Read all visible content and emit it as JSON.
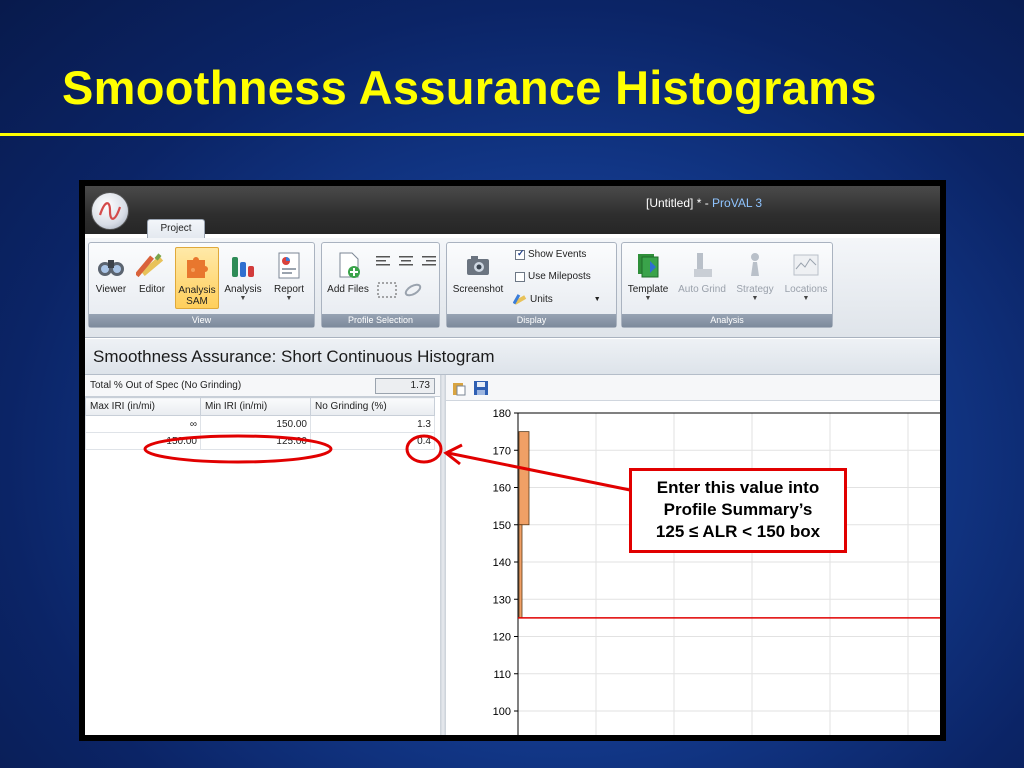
{
  "slide": {
    "title": "Smoothness Assurance Histograms"
  },
  "app": {
    "window_title_prefix": "[Untitled] * - ",
    "window_title_brand": "ProVAL 3",
    "ribbon_tab": "Project",
    "groups": {
      "view": "View",
      "profile_selection": "Profile Selection",
      "display": "Display",
      "analysis": "Analysis"
    },
    "buttons": {
      "viewer": "Viewer",
      "editor": "Editor",
      "analysis_sam_line1": "Analysis",
      "analysis_sam_line2": "SAM",
      "analysis": "Analysis",
      "report": "Report",
      "add_files": "Add Files",
      "screenshot": "Screenshot",
      "show_events": "Show Events",
      "use_mileposts": "Use Mileposts",
      "units": "Units",
      "template": "Template",
      "auto_grind": "Auto Grind",
      "strategy": "Strategy",
      "locations": "Locations"
    },
    "checkboxes": {
      "show_events_checked": true,
      "use_mileposts_checked": false
    },
    "panel_header": "Smoothness Assurance: Short Continuous Histogram",
    "total": {
      "label": "Total % Out of Spec (No Grinding)",
      "value": "1.73"
    },
    "table": {
      "headers": [
        "Max IRI (in/mi)",
        "Min IRI (in/mi)",
        "No Grinding (%)"
      ],
      "rows": [
        [
          "∞",
          "150.00",
          "1.3"
        ],
        [
          "150.00",
          "125.00",
          "0.4"
        ]
      ]
    }
  },
  "chart_data": {
    "type": "bar",
    "y_ticks": [
      "180",
      "170",
      "160",
      "150",
      "140",
      "130",
      "120",
      "110",
      "100"
    ],
    "ylim": [
      100,
      180
    ],
    "bars": [
      {
        "min": 150,
        "max": 175,
        "color": "#f0a066"
      },
      {
        "min": 125,
        "max": 150,
        "color": "#f0a066"
      }
    ],
    "threshold_line": {
      "value": 125,
      "color": "#e00000"
    },
    "grid": true
  },
  "annotation": {
    "callout_lines": [
      "Enter this value into",
      "Profile Summary’s",
      "125 ≤ ALR < 150 box"
    ],
    "color": "#e10000"
  }
}
